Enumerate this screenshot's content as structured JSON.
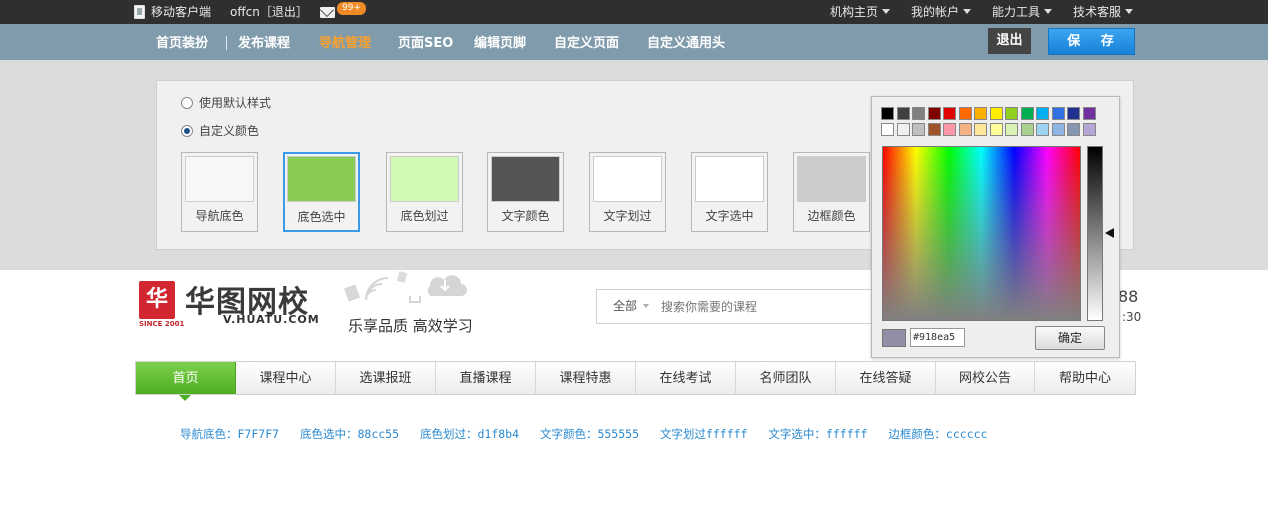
{
  "topbar": {
    "mobile_label": "移动客户端",
    "user_label": "offcn［退出］",
    "mail_badge": "99+",
    "right_links": [
      {
        "label": "机构主页"
      },
      {
        "label": "我的帐户"
      },
      {
        "label": "能力工具"
      },
      {
        "label": "技术客服"
      }
    ]
  },
  "admin_bar": {
    "items": [
      {
        "label": "首页装扮"
      },
      {
        "label": "发布课程"
      },
      {
        "label": "导航管理",
        "active": true
      },
      {
        "label": "页面SEO"
      },
      {
        "label": "编辑页脚"
      },
      {
        "label": "自定义页面"
      },
      {
        "label": "自定义通用头"
      }
    ],
    "exit_label": "退出",
    "save_label": "保  存"
  },
  "style_options": {
    "default_label": "使用默认样式",
    "custom_label": "自定义颜色",
    "selected": "custom"
  },
  "swatches": [
    {
      "label": "导航底色",
      "color": "#F7F7F7"
    },
    {
      "label": "底色选中",
      "color": "#88cc55",
      "selected": true
    },
    {
      "label": "底色划过",
      "color": "#d1f8b4"
    },
    {
      "label": "文字颜色",
      "color": "#555555"
    },
    {
      "label": "文字划过",
      "color": "#ffffff"
    },
    {
      "label": "文字选中",
      "color": "#ffffff"
    },
    {
      "label": "边框颜色",
      "color": "#cccccc"
    }
  ],
  "site": {
    "logo_mark": "华",
    "logo_since": "SINCE 2001",
    "logo_text": "华图网校",
    "logo_url": "V.HUATU.COM",
    "slogan": "乐享品质  高效学习",
    "search_category": "全部",
    "search_placeholder": "搜索你需要的课程",
    "hotline_fragment": "88",
    "hotline_time_fragment": ":30"
  },
  "nav": {
    "items": [
      {
        "label": "首页",
        "active": true
      },
      {
        "label": "课程中心"
      },
      {
        "label": "选课报班"
      },
      {
        "label": "直播课程"
      },
      {
        "label": "课程特惠"
      },
      {
        "label": "在线考试"
      },
      {
        "label": "名师团队"
      },
      {
        "label": "在线答疑"
      },
      {
        "label": "网校公告"
      },
      {
        "label": "帮助中心"
      }
    ]
  },
  "color_summary": [
    "导航底色：F7F7F7",
    "底色选中：88cc55",
    "底色划过：d1f8b4",
    "文字颜色：555555",
    "文字划过ffffff",
    "文字选中：ffffff",
    "边框颜色：cccccc"
  ],
  "picker": {
    "palette_row1": [
      "#000000",
      "#404040",
      "#808080",
      "#800000",
      "#e00000",
      "#ff6a00",
      "#ffb000",
      "#ffee00",
      "#90d020",
      "#00b050",
      "#00b0f0",
      "#3070e0",
      "#203090",
      "#7030a0"
    ],
    "palette_row2": [
      "#ffffff",
      "#f0f0f0",
      "#c0c0c0",
      "#a0522d",
      "#ff99aa",
      "#f4b183",
      "#ffe699",
      "#ffff99",
      "#d9f2b3",
      "#a9d08e",
      "#9dd3f0",
      "#8db4e2",
      "#8497b0",
      "#b4a7d6"
    ],
    "hex_value": "#918ea5",
    "preview_color": "#918ea5",
    "ok_label": "确定"
  }
}
